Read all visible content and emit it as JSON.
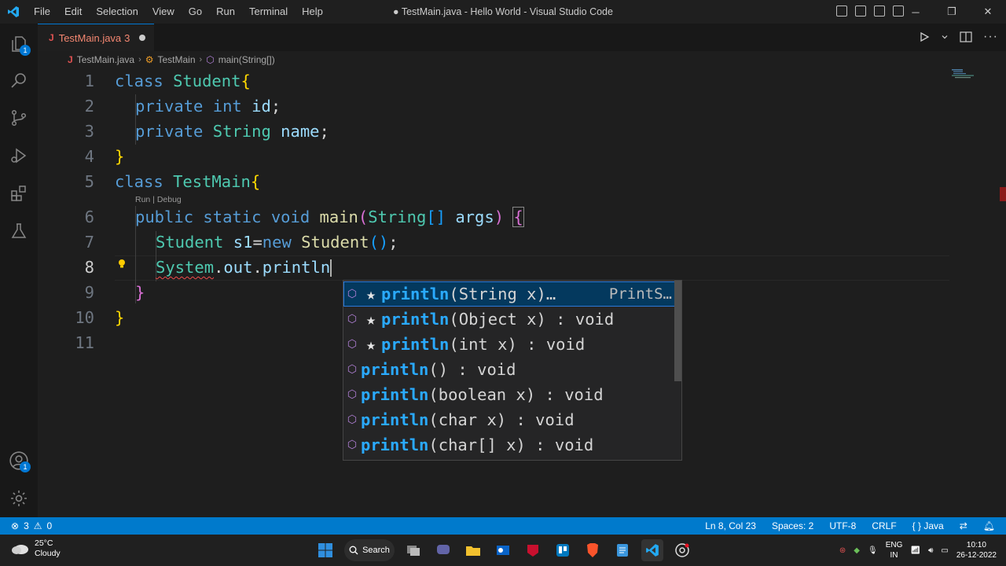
{
  "app": {
    "title": "● TestMain.java - Hello World - Visual Studio Code",
    "menu": [
      "File",
      "Edit",
      "Selection",
      "View",
      "Go",
      "Run",
      "Terminal",
      "Help"
    ]
  },
  "activity_bar": {
    "explorer_badge": "1",
    "accounts_badge": "1"
  },
  "tab": {
    "icon": "J",
    "name": "TestMain.java",
    "problems": "3"
  },
  "breadcrumb": {
    "file": "TestMain.java",
    "class": "TestMain",
    "method": "main(String[])"
  },
  "editor": {
    "line_numbers": [
      "1",
      "2",
      "3",
      "4",
      "5",
      "6",
      "7",
      "8",
      "9",
      "10",
      "11"
    ],
    "active_line": "8",
    "codelens": "Run | Debug",
    "lines": [
      "class Student{",
      "private int id;",
      "private String name;",
      "}",
      "class TestMain{",
      "public static void main(String[] args) {",
      "Student s1=new Student();",
      "System.out.println",
      "}",
      "}"
    ]
  },
  "suggest": {
    "items": [
      {
        "star": true,
        "match": "println",
        "rest": "(String x)…",
        "detail": "PrintS…",
        "selected": true
      },
      {
        "star": true,
        "match": "println",
        "rest": "(Object x) : void",
        "detail": ""
      },
      {
        "star": true,
        "match": "println",
        "rest": "(int x) : void",
        "detail": ""
      },
      {
        "star": false,
        "match": "println",
        "rest": "() : void",
        "detail": ""
      },
      {
        "star": false,
        "match": "println",
        "rest": "(boolean x) : void",
        "detail": ""
      },
      {
        "star": false,
        "match": "println",
        "rest": "(char x) : void",
        "detail": ""
      },
      {
        "star": false,
        "match": "println",
        "rest": "(char[] x) : void",
        "detail": ""
      }
    ],
    "icon": "cube-icon"
  },
  "statusbar": {
    "errors": "3",
    "warnings": "0",
    "position": "Ln 8, Col 23",
    "spaces": "Spaces: 2",
    "encoding": "UTF-8",
    "eol": "CRLF",
    "language": "{ } Java"
  },
  "taskbar": {
    "temp": "25°C",
    "weather": "Cloudy",
    "search": "Search",
    "lang1": "ENG",
    "lang2": "IN",
    "time": "10:10",
    "date": "26-12-2022"
  },
  "colors": {
    "accent": "#007acc",
    "keyword": "#569cd6",
    "type": "#4ec9b0",
    "match": "#2aaaff"
  }
}
